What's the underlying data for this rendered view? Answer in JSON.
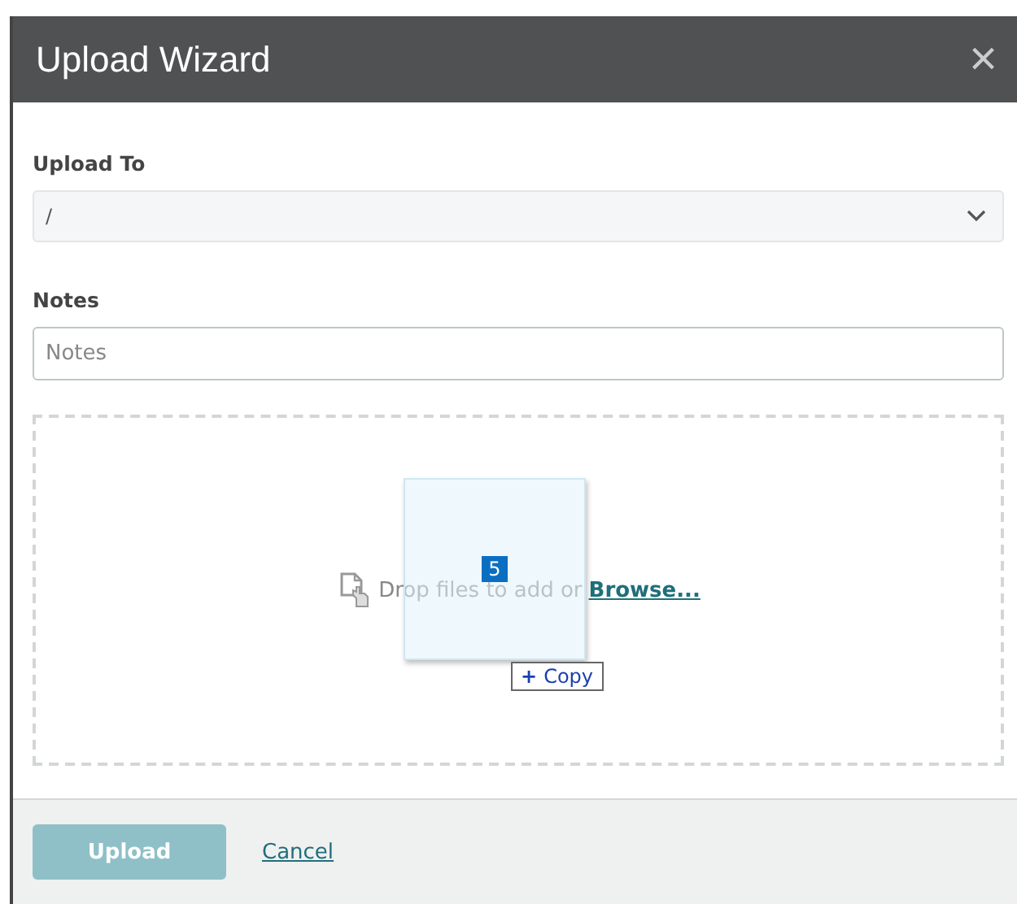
{
  "window": {
    "title": "Upload Wizard",
    "close": "×"
  },
  "upload_to": {
    "label": "Upload To",
    "value": "/"
  },
  "notes": {
    "label": "Notes",
    "placeholder": "Notes"
  },
  "dropzone": {
    "text": "Drop files to add or",
    "link": "Browse..."
  },
  "drag": {
    "count": "5",
    "effect": "Copy",
    "effect_symbol": "+"
  },
  "footer": {
    "upload": {
      "label": "Upload",
      "disabled": true
    },
    "cancel": "Cancel"
  }
}
